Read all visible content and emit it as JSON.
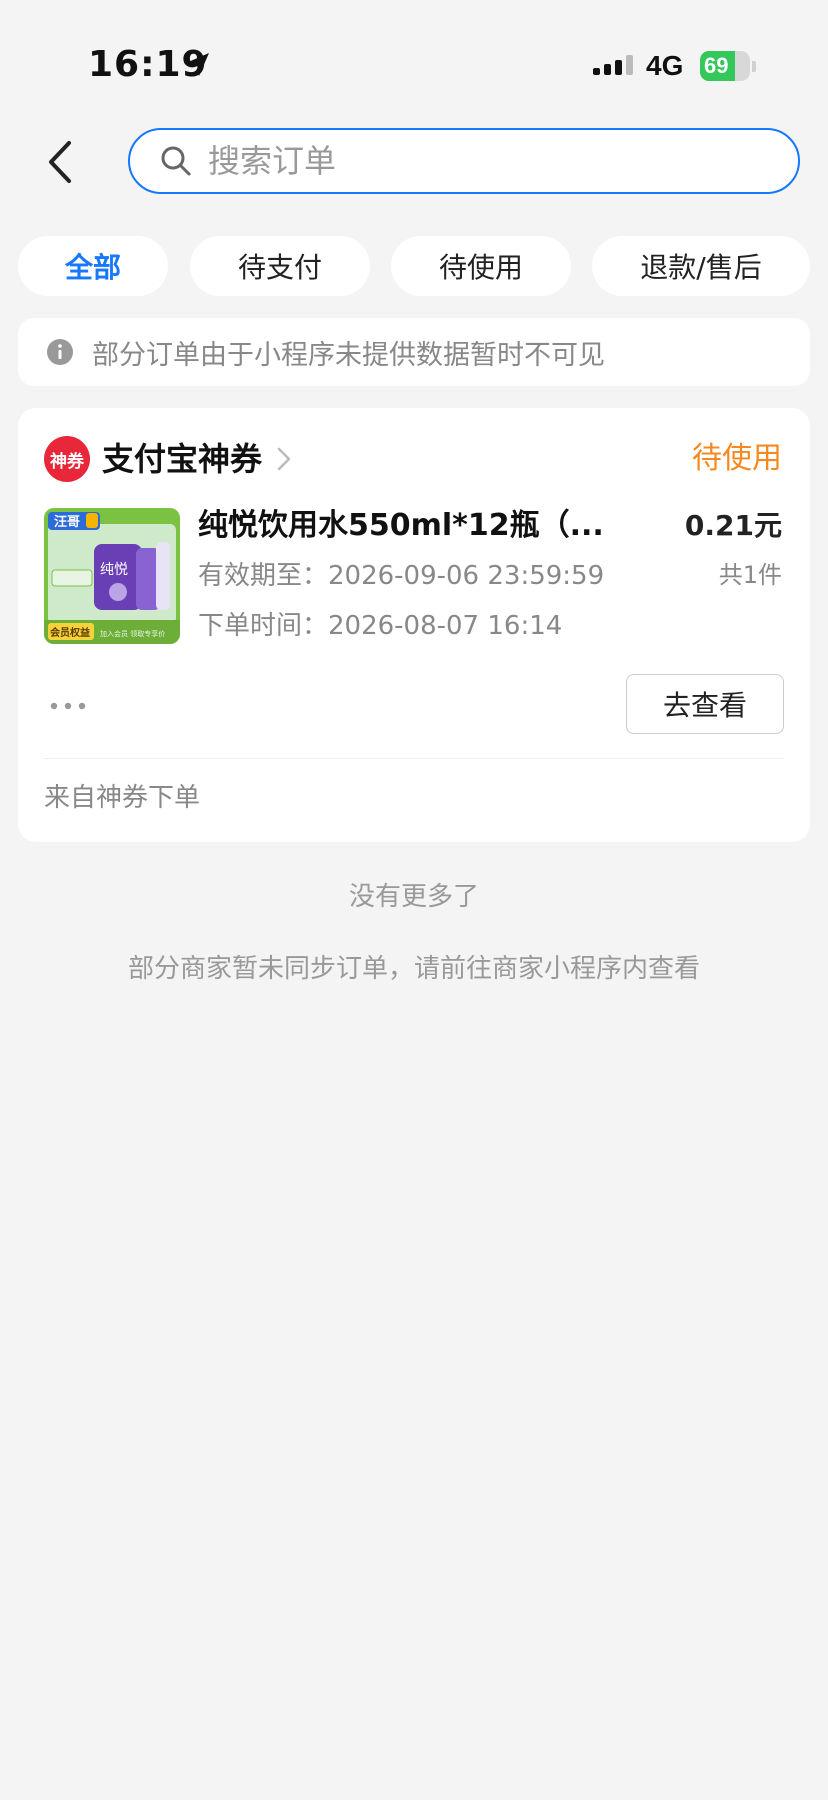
{
  "status_bar": {
    "time": "16:19",
    "network": "4G",
    "battery": "69",
    "battery_level": 0.69
  },
  "header": {
    "search_placeholder": "搜索订单"
  },
  "tabs": [
    {
      "label": "全部",
      "active": true
    },
    {
      "label": "待支付",
      "active": false
    },
    {
      "label": "待使用",
      "active": false
    },
    {
      "label": "退款/售后",
      "active": false
    }
  ],
  "notice": {
    "text": "部分订单由于小程序未提供数据暂时不可见"
  },
  "order": {
    "shop_logo_text": "神券",
    "shop_name": "支付宝神券",
    "status": "待使用",
    "product_title": "纯悦饮用水550ml*12瓶（...",
    "price": "0.21元",
    "quantity": "共1件",
    "valid_until": "有效期至：2026-09-06 23:59:59",
    "order_time": "下单时间：2026-08-07 16:14",
    "action_label": "去查看",
    "source": "来自神券下单",
    "thumb": {
      "brand": "汪哥",
      "product_word": "纯悦",
      "badge": "会员权益",
      "tagline": "加入会员 领取专享价"
    }
  },
  "footer": {
    "no_more": "没有更多了",
    "sync_note": "部分商家暂未同步订单，请前往商家小程序内查看"
  },
  "colors": {
    "accent": "#1677ff",
    "status_orange": "#f5881f",
    "logo_red": "#e8273a",
    "thumb_green": "#7bc142",
    "thumb_purple": "#6a3fb5"
  }
}
